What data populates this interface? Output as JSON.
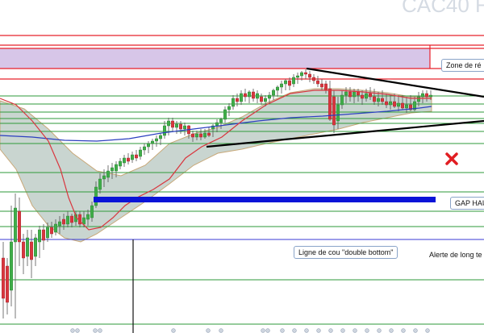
{
  "chart_data": {
    "type": "candlestick",
    "title": "CAC40 F",
    "annotations": {
      "resistance_zone": "Zone de ré",
      "gap": "GAP HAU",
      "neckline": "Ligne de cou \"double bottom\"",
      "long_alert": "Alerte de long te"
    },
    "colors": {
      "up": "#3fae49",
      "down": "#d9363e",
      "resistance_line": "#e8202a",
      "support_line": "#2e9a3a",
      "gap_bar": "#0a14d8",
      "neckline": "#3a3ad6",
      "zone_fill": "#c9b3e0",
      "triangle": "#000000",
      "cross": "#e11d22"
    },
    "grid": false,
    "legend": "none"
  }
}
